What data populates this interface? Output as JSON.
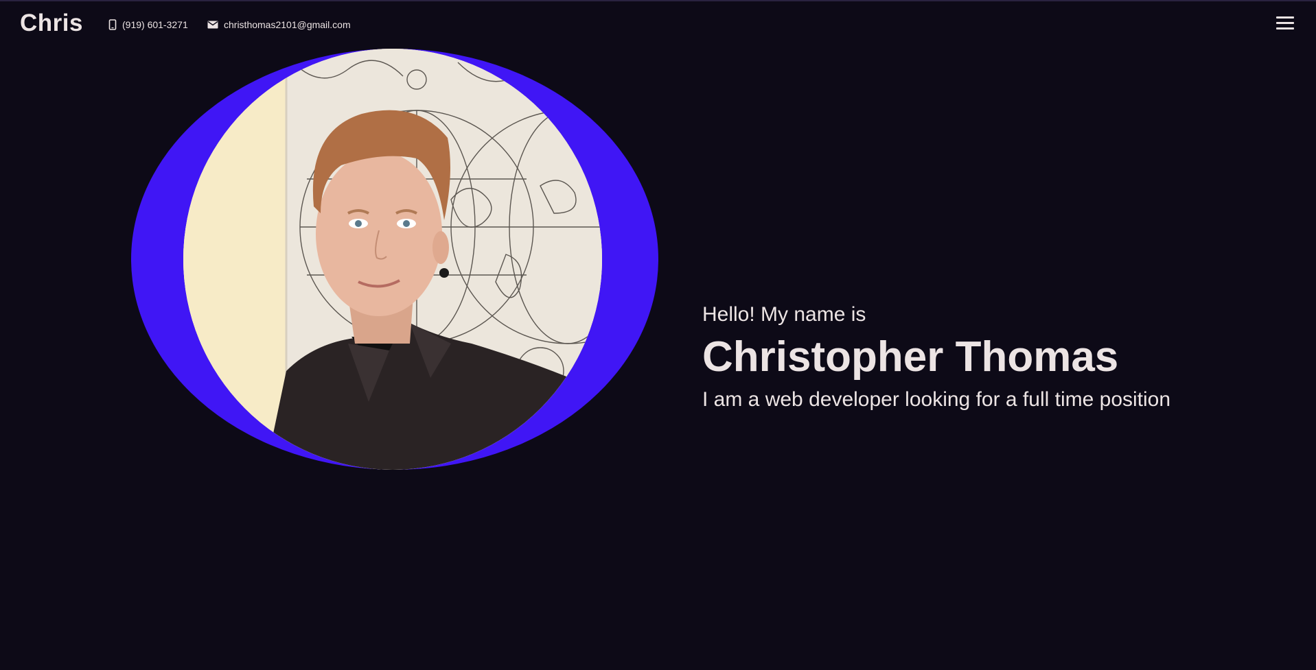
{
  "header": {
    "brand": "Chris",
    "phone": "(919) 601-3271",
    "email": "christhomas2101@gmail.com",
    "icons": {
      "phone": "phone-icon",
      "email": "envelope-icon",
      "menu": "hamburger-menu-icon"
    }
  },
  "hero": {
    "greeting": "Hello! My name is",
    "name": "Christopher Thomas",
    "tagline": "I am a web developer looking for a full time position"
  },
  "colors": {
    "background": "#0d0a17",
    "accent": "#4016f5",
    "text": "#ece4e4"
  }
}
